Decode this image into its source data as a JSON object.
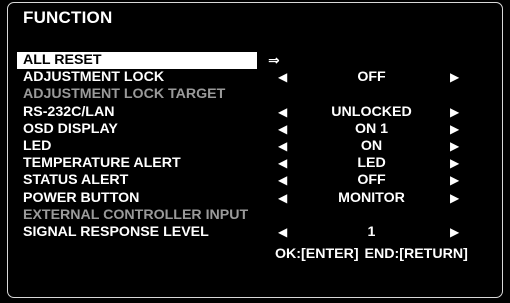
{
  "title": "FUNCTION",
  "rows": [
    {
      "label": "ALL RESET",
      "value": "",
      "state": "selected",
      "arrows": "enter",
      "enter_glyph": "⇒"
    },
    {
      "label": "ADJUSTMENT LOCK",
      "value": "OFF",
      "state": "normal",
      "arrows": "both"
    },
    {
      "label": "ADJUSTMENT LOCK TARGET",
      "value": "",
      "state": "disabled",
      "arrows": "none"
    },
    {
      "label": "RS-232C/LAN",
      "value": "UNLOCKED",
      "state": "normal",
      "arrows": "both"
    },
    {
      "label": "OSD DISPLAY",
      "value": "ON 1",
      "state": "normal",
      "arrows": "both"
    },
    {
      "label": "LED",
      "value": "ON",
      "state": "normal",
      "arrows": "both"
    },
    {
      "label": "TEMPERATURE ALERT",
      "value": "LED",
      "state": "normal",
      "arrows": "both"
    },
    {
      "label": "STATUS ALERT",
      "value": "OFF",
      "state": "normal",
      "arrows": "both"
    },
    {
      "label": "POWER BUTTON",
      "value": "MONITOR",
      "state": "normal",
      "arrows": "both"
    },
    {
      "label": "EXTERNAL CONTROLLER INPUT",
      "value": "",
      "state": "disabled",
      "arrows": "none"
    },
    {
      "label": "SIGNAL RESPONSE LEVEL",
      "value": "1",
      "state": "normal",
      "arrows": "both"
    }
  ],
  "arrow_glyphs": {
    "left": "◀",
    "right": "▶"
  },
  "footer": {
    "ok": "OK:[ENTER]",
    "end": "END:[RETURN]"
  },
  "colors": {
    "background": "#000000",
    "text": "#ffffff",
    "disabled_text": "#9a9a9a",
    "highlight": "#ffffff"
  }
}
